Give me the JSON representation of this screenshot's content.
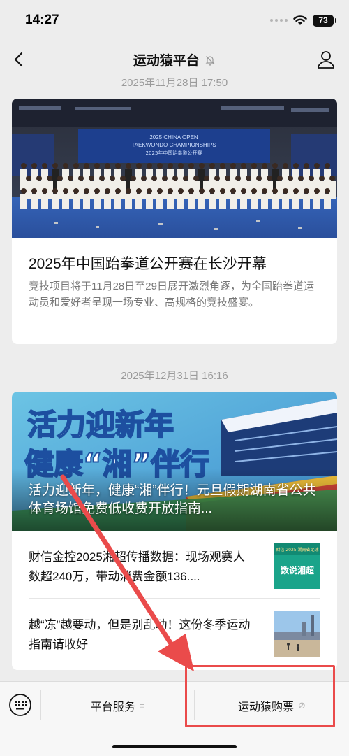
{
  "status": {
    "time": "14:27",
    "battery": "73"
  },
  "nav": {
    "title": "运动猿平台"
  },
  "feed": {
    "timestamp1": "2025年11月28日 17:50",
    "article1": {
      "title": "2025年中国跆拳道公开赛在长沙开幕",
      "desc": "竞技项目将于11月28日至29日展开激烈角逐，为全国跆拳道运动员和爱好者呈现一场专业、高规格的竞技盛宴。",
      "image_banner_line1": "2025 CHINA OPEN",
      "image_banner_line2": "TAEKWONDO CHAMPIONSHIPS",
      "image_banner_line3": "2025年中国跆拳道公开赛"
    },
    "timestamp2": "2025年12月31日 16:16",
    "article2": {
      "headline": "活力迎新年，健康“湘”伴行！元旦假期湖南省公共体育场馆免费低收费开放指南...",
      "banner_line1": "活力迎新年",
      "banner_line2": "健康“湘”伴行",
      "sub1": "财信金控2025湘超传播数据：现场观赛人数超240万，带动消费金额136....",
      "sub1_thumb_line1": "财信 2025 湖南省足球",
      "sub1_thumb_line2": "数说湘超",
      "sub2": "越“冻”越要动，但是别乱动！这份冬季运动指南请收好"
    }
  },
  "bottom": {
    "menu1": "平台服务",
    "menu1_icon": "≡",
    "menu2": "运动猿购票",
    "menu2_icon": "⊘"
  },
  "colors": {
    "annotation": "#ea4b4b",
    "background": "#ededed"
  }
}
